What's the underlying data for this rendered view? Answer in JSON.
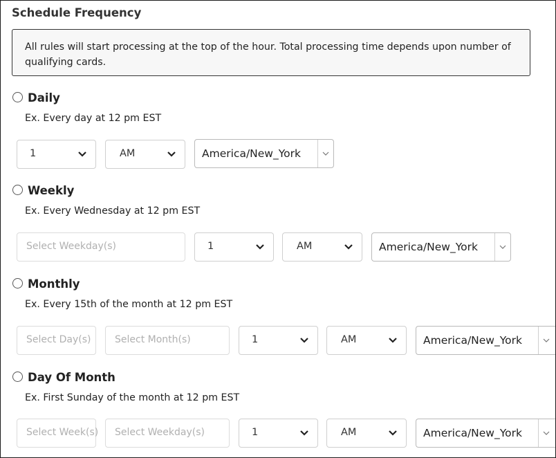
{
  "section_title": "Schedule Frequency",
  "info_text": "All rules will start processing at the top of the hour. Total processing time depends upon number of qualifying cards.",
  "options": {
    "daily": {
      "label": "Daily",
      "example": "Ex. Every day at 12 pm EST",
      "hour": "1",
      "meridiem": "AM",
      "timezone": "America/New_York"
    },
    "weekly": {
      "label": "Weekly",
      "example": "Ex. Every Wednesday at 12 pm EST",
      "weekday_placeholder": "Select Weekday(s)",
      "hour": "1",
      "meridiem": "AM",
      "timezone": "America/New_York"
    },
    "monthly": {
      "label": "Monthly",
      "example": "Ex. Every 15th of the month at 12 pm EST",
      "day_placeholder": "Select Day(s)",
      "month_placeholder": "Select Month(s)",
      "hour": "1",
      "meridiem": "AM",
      "timezone": "America/New_York"
    },
    "day_of_month": {
      "label": "Day Of Month",
      "example": "Ex. First Sunday of the month at 12 pm EST",
      "week_placeholder": "Select Week(s)",
      "weekday_placeholder": "Select Weekday(s)",
      "hour": "1",
      "meridiem": "AM",
      "timezone": "America/New_York"
    }
  },
  "icons": {
    "select_arrow": "chevron-down-icon",
    "timezone_arrow": "chevron-down-icon",
    "radio": "radio-unchecked"
  }
}
